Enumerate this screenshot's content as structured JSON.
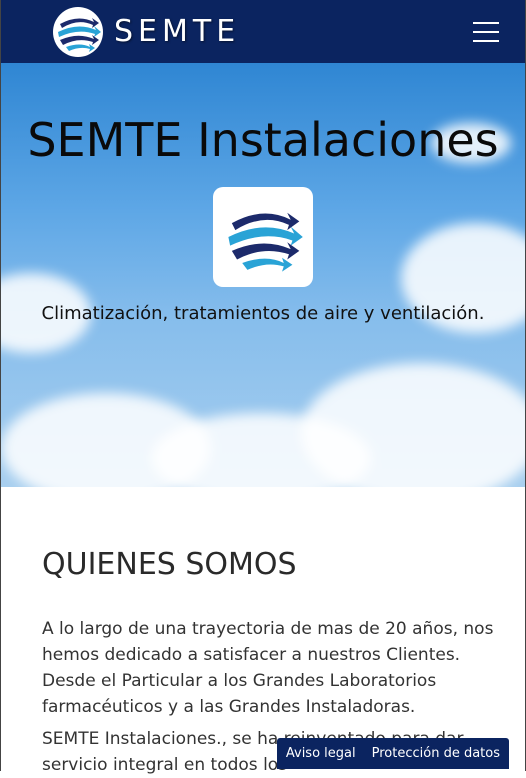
{
  "navbar": {
    "brand_text": "SEMTE",
    "logo_icon": "globe-arrows-icon",
    "menu_icon": "hamburger-menu-icon"
  },
  "hero": {
    "title": "SEMTE Instalaciones",
    "logo_icon": "globe-arrows-icon",
    "subtitle": "Climatización, tratamientos de aire y ventilación."
  },
  "about": {
    "title": "QUIENES SOMOS",
    "paragraph1": "A lo largo de una trayectoria de mas de 20 años, nos hemos dedicado a satisfacer a nuestros Clientes. Desde el Particular a los Grandes Laboratorios farmacéuticos y a las Grandes Instaladoras.",
    "paragraph2": "SEMTE Instalaciones., se ha reinventado para dar servicio integral en todos los"
  },
  "footer": {
    "legal_link": "Aviso legal",
    "privacy_link": "Protección de datos"
  },
  "colors": {
    "navbar_bg": "#0b2460",
    "logo_dark_blue": "#1c2a6b",
    "logo_light_blue": "#29a3d6"
  }
}
